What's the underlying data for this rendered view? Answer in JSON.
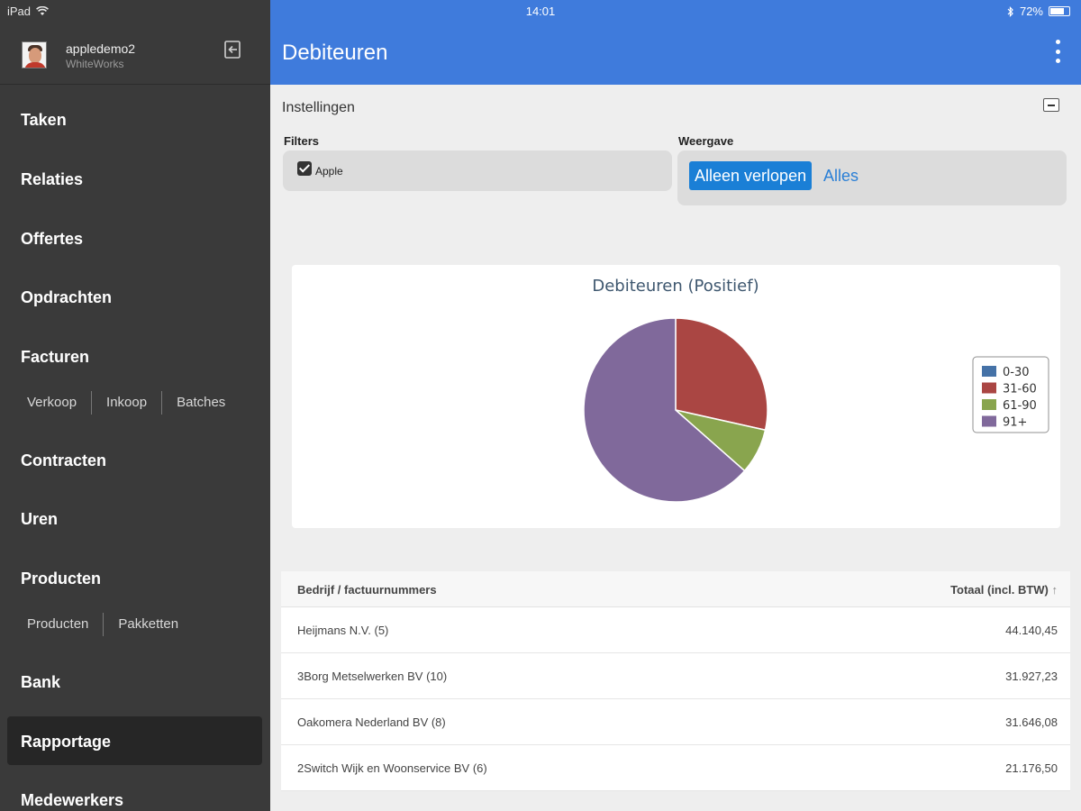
{
  "status": {
    "device": "iPad",
    "time": "14:01",
    "battery": "72%"
  },
  "user": {
    "name": "appledemo2",
    "org": "WhiteWorks"
  },
  "nav": {
    "taken": "Taken",
    "relaties": "Relaties",
    "offertes": "Offertes",
    "opdrachten": "Opdrachten",
    "facturen": "Facturen",
    "facturen_sub": [
      "Verkoop",
      "Inkoop",
      "Batches"
    ],
    "contracten": "Contracten",
    "uren": "Uren",
    "producten": "Producten",
    "producten_sub": [
      "Producten",
      "Pakketten"
    ],
    "bank": "Bank",
    "rapportage": "Rapportage",
    "medewerkers": "Medewerkers"
  },
  "header": {
    "title": "Debiteuren"
  },
  "settings": {
    "title": "Instellingen",
    "filters_label": "Filters",
    "filter_item": "Apple",
    "view_label": "Weergave",
    "view_active": "Alleen verlopen",
    "view_other": "Alles"
  },
  "chart_data": {
    "type": "pie",
    "title": "Debiteuren (Positief)",
    "legend_position": "right",
    "slices": [
      {
        "name": "0-30",
        "value": 0,
        "color": "#4572a7"
      },
      {
        "name": "31-60",
        "value": 28.5,
        "color": "#aa4643"
      },
      {
        "name": "61-90",
        "value": 8.0,
        "color": "#89a54e"
      },
      {
        "name": "91+",
        "value": 63.5,
        "color": "#80699b"
      }
    ]
  },
  "table": {
    "col1": "Bedrijf / factuurnummers",
    "col2": "Totaal (incl. BTW)",
    "sort_icon": "↑",
    "rows": [
      {
        "name": "Heijmans N.V. (5)",
        "total": "44.140,45"
      },
      {
        "name": "3Borg Metselwerken BV (10)",
        "total": "31.927,23"
      },
      {
        "name": "Oakomera Nederland BV (8)",
        "total": "31.646,08"
      },
      {
        "name": "2Switch Wijk en Woonservice BV (6)",
        "total": "21.176,50"
      }
    ]
  }
}
